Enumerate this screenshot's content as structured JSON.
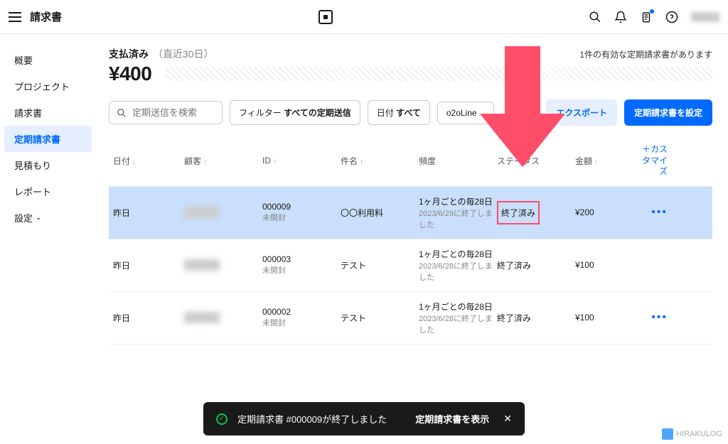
{
  "topbar": {
    "title": "請求書"
  },
  "sidebar": {
    "items": [
      {
        "label": "概要"
      },
      {
        "label": "プロジェクト"
      },
      {
        "label": "請求書"
      },
      {
        "label": "定期請求書"
      },
      {
        "label": "見積もり"
      },
      {
        "label": "レポート"
      },
      {
        "label": "設定"
      }
    ]
  },
  "summary": {
    "status": "支払済み",
    "period": "（直近30日）",
    "amount": "¥400",
    "notice": "1件の有効な定期請求書があります"
  },
  "filters": {
    "search_placeholder": "定期送信を検索",
    "filter_label": "フィルター",
    "filter_value": "すべての定期送信",
    "date_label": "日付",
    "date_value": "すべて",
    "profile": "o2oLine",
    "export": "エクスポート",
    "settings": "定期請求書を設定"
  },
  "table": {
    "headers": [
      "日付",
      "顧客",
      "ID",
      "件名",
      "頻度",
      "ステータス",
      "金額"
    ],
    "customize": "＋カスタマイズ",
    "rows": [
      {
        "date": "昨日",
        "id": "000009",
        "id_sub": "未開封",
        "subject": "〇〇利用料",
        "freq": "1ヶ月ごとの毎28日",
        "freq_sub": "2023/6/29に終了しました",
        "status": "終了済み",
        "amount": "¥200"
      },
      {
        "date": "昨日",
        "id": "000003",
        "id_sub": "未開封",
        "subject": "テスト",
        "freq": "1ヶ月ごとの毎28日",
        "freq_sub": "2023/6/28に終了しました",
        "status": "終了済み",
        "amount": "¥100"
      },
      {
        "date": "昨日",
        "id": "000002",
        "id_sub": "未開封",
        "subject": "テスト",
        "freq": "1ヶ月ごとの毎28日",
        "freq_sub": "2023/6/28に終了しました",
        "status": "終了済み",
        "amount": "¥100"
      }
    ]
  },
  "toast": {
    "message": "定期請求書 #000009が終了しました",
    "action": "定期請求書を表示"
  },
  "watermark": {
    "text": "HIRAKULOG"
  }
}
